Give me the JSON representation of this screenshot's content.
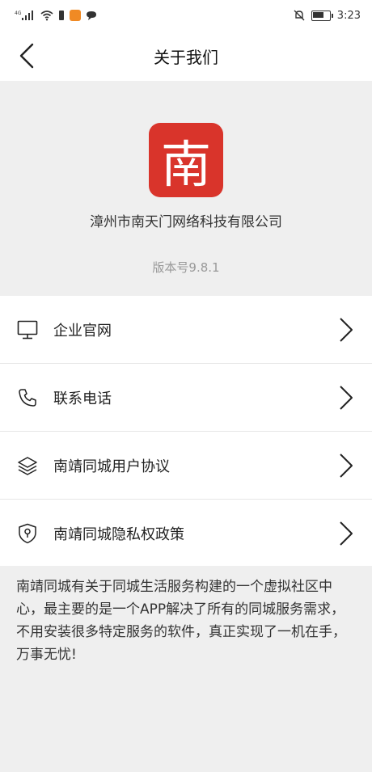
{
  "status_bar": {
    "signal": "4G",
    "time": "3:23"
  },
  "header": {
    "title": "关于我们"
  },
  "app": {
    "logo_char": "南",
    "company": "漳州市南天门网络科技有限公司",
    "version": "版本号9.8.1"
  },
  "menu": {
    "items": [
      {
        "label": "企业官网",
        "icon": "monitor-icon"
      },
      {
        "label": "联系电话",
        "icon": "phone-icon"
      },
      {
        "label": "南靖同城用户协议",
        "icon": "layers-icon"
      },
      {
        "label": "南靖同城隐私权政策",
        "icon": "shield-icon"
      }
    ]
  },
  "about": {
    "text": "南靖同城有关于同城生活服务构建的一个虚拟社区中心，最主要的是一个APP解决了所有的同城服务需求，不用安装很多特定服务的软件，真正实现了一机在手，万事无忧!"
  },
  "colors": {
    "logo_bg": "#d9342b",
    "header_bg": "#efefef"
  }
}
